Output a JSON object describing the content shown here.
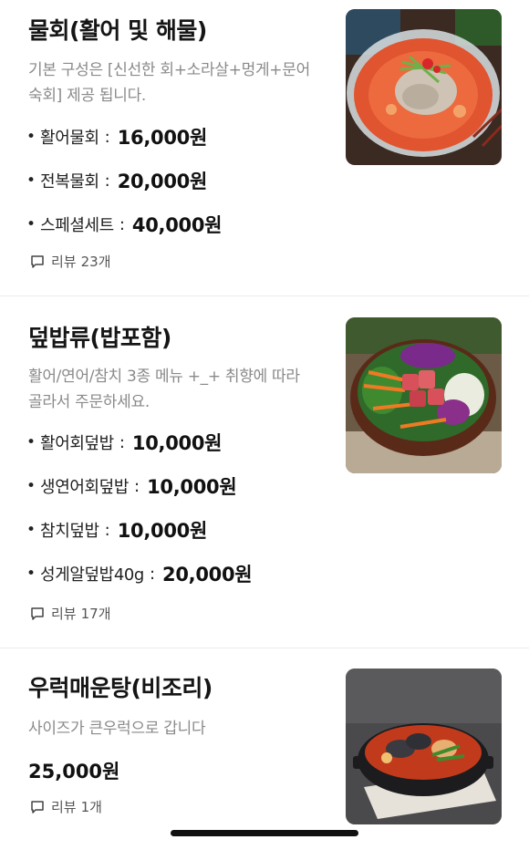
{
  "menu": [
    {
      "title": "물회(활어 및 해물)",
      "description": "기본 구성은 [신선한 회+소라살+멍게+문어숙회] 제공 됩니다.",
      "options": [
        {
          "name": "활어물회",
          "price": "16,000원"
        },
        {
          "name": "전복물회",
          "price": "20,000원"
        },
        {
          "name": "스페셜세트",
          "price": "40,000원"
        }
      ],
      "review_label": "리뷰",
      "review_count": "23개",
      "image_icon": "mulhoe-photo"
    },
    {
      "title": "덮밥류(밥포함)",
      "description": "활어/연어/참치 3종 메뉴 +_+ 취향에 따라 골라서 주문하세요.",
      "options": [
        {
          "name": "활어회덮밥",
          "price": "10,000원"
        },
        {
          "name": "생연어회덮밥",
          "price": "10,000원"
        },
        {
          "name": "참치덮밥",
          "price": "10,000원"
        },
        {
          "name": "성게알덮밥40g",
          "price": "20,000원"
        }
      ],
      "review_label": "리뷰",
      "review_count": "17개",
      "image_icon": "deopbap-photo"
    },
    {
      "title": "우럭매운탕(비조리)",
      "description": "사이즈가 큰우럭으로 갑니다",
      "price": "25,000원",
      "review_label": "리뷰",
      "review_count": "1개",
      "image_icon": "maeuntang-photo"
    }
  ],
  "colors": {
    "title": "#151515",
    "description": "#8a8a8a",
    "divider": "#ececec",
    "home_indicator": "#111111"
  },
  "icons": {
    "bullet": "•",
    "separator": ":",
    "review": "speech-bubble-icon"
  }
}
